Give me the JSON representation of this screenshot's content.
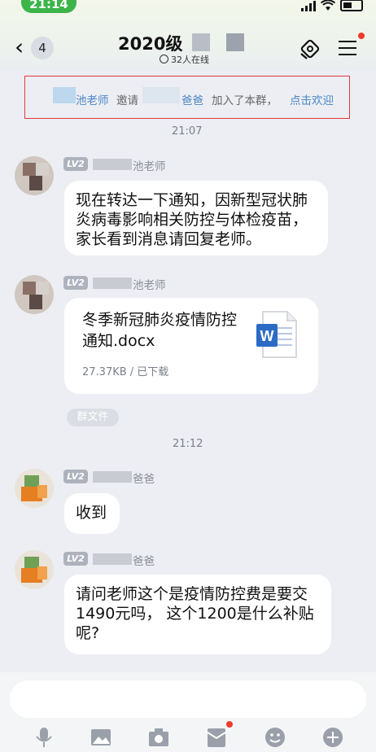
{
  "status": {
    "time": "21:14"
  },
  "header": {
    "back_count": "4",
    "title": "2020级",
    "online": "32人在线"
  },
  "notice": {
    "inviter": "池老师",
    "invite_word": "邀请",
    "invitee": "爸爸",
    "joined": "加入了本群，",
    "welcome": "点击欢迎"
  },
  "timestamps": [
    "21:07",
    "21:12"
  ],
  "messages": [
    {
      "level": "LV2",
      "sender": "池老师",
      "text": "现在转达一下通知，因新型冠状肺炎病毒影响相关防控与体检疫苗，家长看到消息请回复老师。"
    },
    {
      "level": "LV2",
      "sender": "池老师",
      "file_name": "冬季新冠肺炎疫情防控通知.docx",
      "file_meta": "27.37KB / 已下载",
      "file_icon": "word-doc-icon"
    },
    {
      "level": "LV2",
      "sender": "爸爸",
      "text": "收到"
    },
    {
      "level": "LV2",
      "sender": "爸爸",
      "text": "请问老师这个是疫情防控费是要交1490元吗， 这个1200是什么补贴呢?"
    }
  ],
  "group_file_chip": "群文件",
  "toolbar": [
    "mic-icon",
    "image-icon",
    "camera-icon",
    "red-packet-icon",
    "emoji-icon",
    "plus-icon"
  ],
  "colors": {
    "accent_red": "#e23b3b",
    "link_blue": "#4a86c5",
    "word_blue": "#2b6bc6",
    "online_green": "#3bb54a"
  }
}
